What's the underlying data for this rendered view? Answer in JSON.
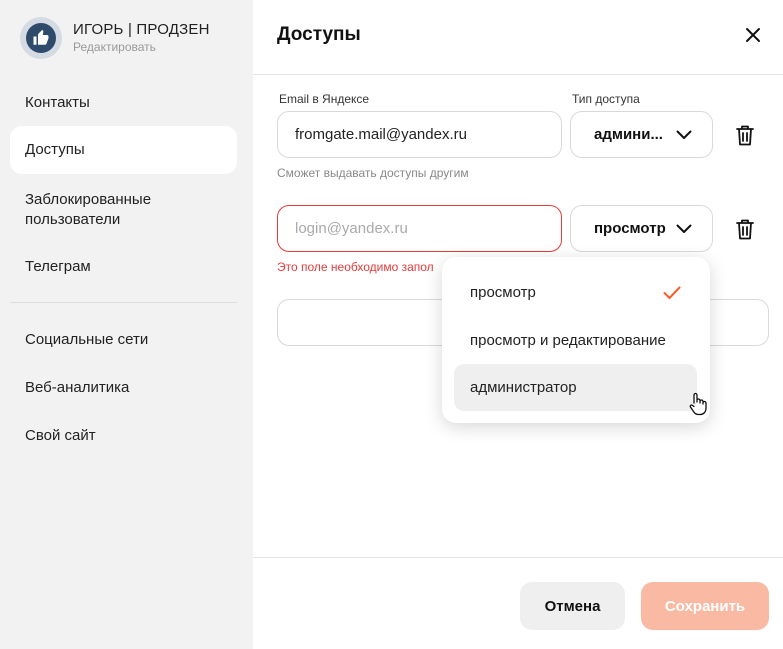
{
  "profile": {
    "name": "ИГОРЬ | ПРОДЗЕН",
    "edit_label": "Редактировать"
  },
  "sidebar": {
    "items": [
      {
        "label": "Контакты"
      },
      {
        "label": "Доступы"
      },
      {
        "label": "Заблокированные пользователи"
      },
      {
        "label": "Телеграм"
      },
      {
        "label": "Социальные сети"
      },
      {
        "label": "Веб-аналитика"
      },
      {
        "label": "Свой сайт"
      }
    ]
  },
  "main": {
    "title": "Доступы",
    "email_label": "Email в Яндексе",
    "type_label": "Тип доступа",
    "rows": [
      {
        "email": "fromgate.mail@yandex.ru",
        "access": "админи...",
        "hint": "Сможет выдавать доступы другим"
      },
      {
        "email_placeholder": "login@yandex.ru",
        "access": "просмотр",
        "error": "Это поле необходимо запол"
      }
    ],
    "dropdown": {
      "options": [
        {
          "label": "просмотр",
          "checked": true
        },
        {
          "label": "просмотр и редактирование"
        },
        {
          "label": "администратор"
        }
      ]
    },
    "cancel_label": "Отмена",
    "save_label": "Сохранить"
  },
  "colors": {
    "accent": "#fc5d2b",
    "error": "#e43b3b",
    "save_disabled": "#f9b9a3",
    "sidebar_bg": "#f2f2f2"
  }
}
